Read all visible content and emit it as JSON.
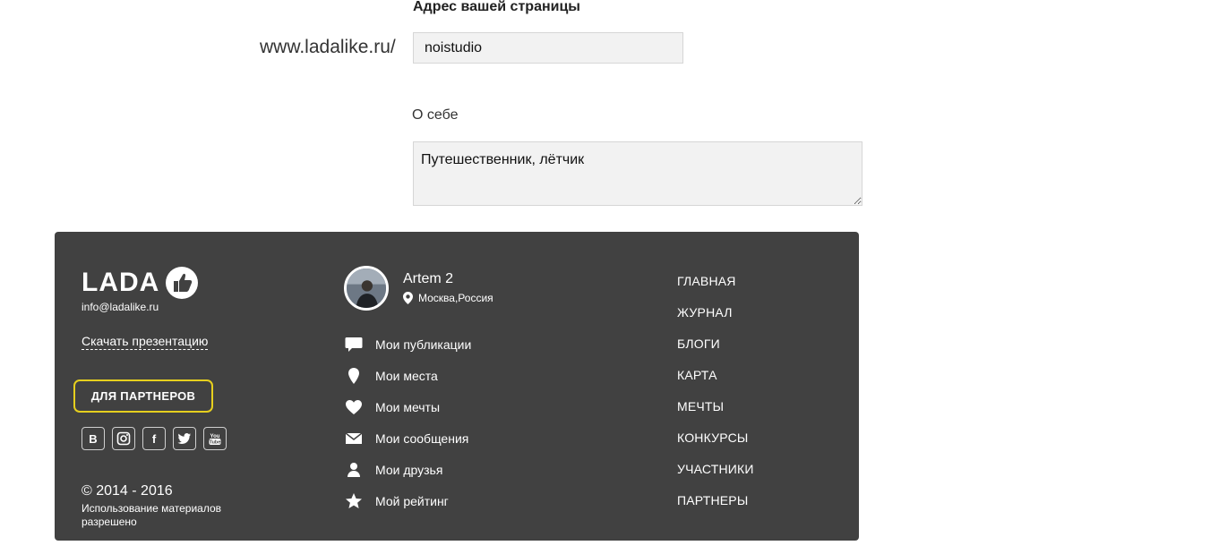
{
  "form": {
    "address_label": "Адрес вашей страницы",
    "url_prefix": "www.ladalike.ru/",
    "slug_value": "noistudio",
    "about_label": "О себе",
    "about_value": "Путешественник, лётчик"
  },
  "footer": {
    "logo_text": "LADA",
    "email": "info@ladalike.ru",
    "download_label": "Скачать презентацию",
    "partners_button": "ДЛЯ ПАРТНЕРОВ",
    "socials": [
      {
        "label": "B",
        "icon": "vk-icon"
      },
      {
        "label": "",
        "icon": "instagram-icon"
      },
      {
        "label": "f",
        "icon": "facebook-icon"
      },
      {
        "label": "",
        "icon": "twitter-icon"
      },
      {
        "label": "You Tube",
        "icon": "youtube-icon"
      }
    ],
    "copyright": "© 2014 - 2016",
    "usage_note": "Использование материалов разрешено",
    "accent_color": "#e6cf1e",
    "background_color": "#414141"
  },
  "user": {
    "name": "Artem 2",
    "location": "Москва,Россия"
  },
  "menu": [
    {
      "label": "Мои публикации",
      "icon": "speech-bubble-icon"
    },
    {
      "label": "Мои места",
      "icon": "location-pin-icon"
    },
    {
      "label": "Мои мечты",
      "icon": "heart-icon"
    },
    {
      "label": "Мои сообщения",
      "icon": "envelope-icon"
    },
    {
      "label": "Мои друзья",
      "icon": "person-icon"
    },
    {
      "label": "Мой рейтинг",
      "icon": "star-icon"
    }
  ],
  "nav": [
    "ГЛАВНАЯ",
    "ЖУРНАЛ",
    "БЛОГИ",
    "КАРТА",
    "МЕЧТЫ",
    "КОНКУРСЫ",
    "УЧАСТНИКИ",
    "ПАРТНЕРЫ"
  ]
}
